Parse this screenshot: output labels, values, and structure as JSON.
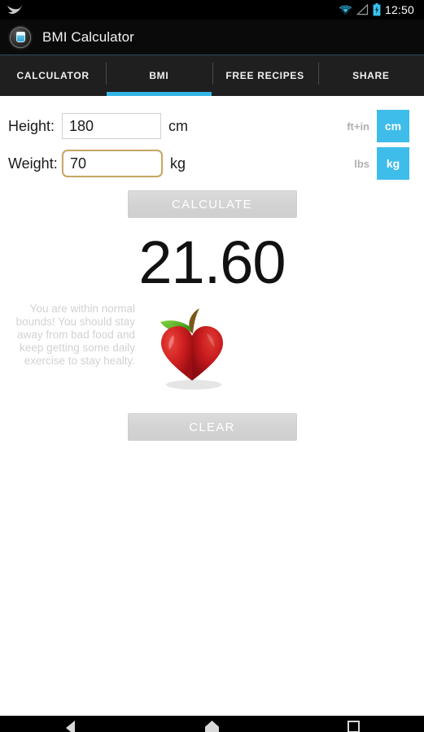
{
  "statusbar": {
    "bird_icon": "bird-icon",
    "wifi_icon": "wifi-icon",
    "signal_icon": "signal-icon",
    "battery_icon": "battery-icon",
    "clock": "12:50"
  },
  "actionbar": {
    "app_icon": "app-glass-icon",
    "title": "BMI Calculator"
  },
  "tabs": [
    {
      "label": "CALCULATOR",
      "active": false
    },
    {
      "label": "BMI",
      "active": true
    },
    {
      "label": "FREE RECIPES",
      "active": false
    },
    {
      "label": "SHARE",
      "active": false
    }
  ],
  "form": {
    "height": {
      "label": "Height:",
      "value": "180",
      "placeholder": "",
      "unit_suffix": "cm",
      "unit_inactive": "ft+in",
      "unit_active": "cm",
      "focused": false
    },
    "weight": {
      "label": "Weight:",
      "value": "70",
      "placeholder": "",
      "unit_suffix": "kg",
      "unit_inactive": "lbs",
      "unit_active": "kg",
      "focused": true
    }
  },
  "actions": {
    "calculate_label": "CALCULATE",
    "clear_label": "CLEAR"
  },
  "result": {
    "bmi_value": "21.60",
    "advice": "You are within normal bounds! You should stay away from bad food and keep getting some daily exercise to stay healty.",
    "image_icon": "apple-heart-icon"
  },
  "navbar": {
    "back_icon": "back-triangle-icon",
    "home_icon": "home-icon",
    "recents_icon": "recents-square-icon"
  },
  "colors": {
    "accent_blue": "#33b5e5",
    "unit_blue": "#3fbdea",
    "focus_border": "#c6a869",
    "tabbar_bg": "#1f1f1f",
    "actionbar_bg": "#0a0a0a",
    "advice_grey": "#d2d2d2",
    "button_grey": "#d3d3d3"
  }
}
